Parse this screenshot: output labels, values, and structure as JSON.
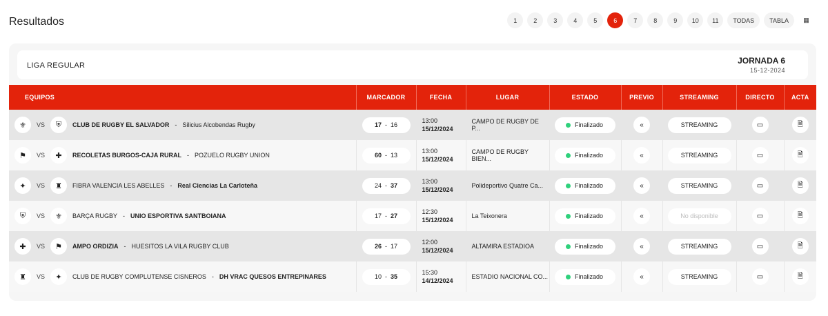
{
  "title": "Resultados",
  "pager": {
    "items": [
      "1",
      "2",
      "3",
      "4",
      "5",
      "6",
      "7",
      "8",
      "9",
      "10",
      "11",
      "TODAS",
      "TABLA"
    ],
    "active": "6",
    "grid_icon": "grid-icon"
  },
  "section": {
    "label": "LIGA REGULAR",
    "jornada": "JORNADA 6",
    "date": "15-12-2024"
  },
  "columns": [
    "EQUIPOS",
    "MARCADOR",
    "FECHA",
    "LUGAR",
    "ESTADO",
    "PREVIO",
    "STREAMING",
    "DIRECTO",
    "ACTA"
  ],
  "accent": "#e3230b",
  "status_color": "#2fd17c",
  "matches": [
    {
      "home": "CLUB DE RUGBY EL SALVADOR",
      "away": "Silicius Alcobendas Rugby",
      "hs": "17",
      "as": "16",
      "winner": "home",
      "time": "13:00",
      "date": "15/12/2024",
      "place": "CAMPO DE RUGBY DE P...",
      "status": "Finalizado",
      "streaming": "STREAMING",
      "vs": "VS"
    },
    {
      "home": "RECOLETAS BURGOS-CAJA RURAL",
      "away": "POZUELO RUGBY UNION",
      "hs": "60",
      "as": "13",
      "winner": "home",
      "time": "13:00",
      "date": "15/12/2024",
      "place": "CAMPO DE RUGBY BIEN...",
      "status": "Finalizado",
      "streaming": "STREAMING",
      "vs": "VS"
    },
    {
      "home": "FIBRA VALENCIA LES ABELLES",
      "away": "Real Ciencias La Carloteña",
      "hs": "24",
      "as": "37",
      "winner": "away",
      "time": "13:00",
      "date": "15/12/2024",
      "place": "Polideportivo Quatre Ca...",
      "status": "Finalizado",
      "streaming": "STREAMING",
      "vs": "VS"
    },
    {
      "home": "BARÇA RUGBY",
      "away": "UNIO ESPORTIVA SANTBOIANA",
      "hs": "17",
      "as": "27",
      "winner": "away",
      "time": "12:30",
      "date": "15/12/2024",
      "place": "La Teixonera",
      "status": "Finalizado",
      "streaming": "No disponible",
      "vs": "VS"
    },
    {
      "home": "AMPO ORDIZIA",
      "away": "HUESITOS LA VILA RUGBY CLUB",
      "hs": "26",
      "as": "17",
      "winner": "home",
      "time": "12:00",
      "date": "15/12/2024",
      "place": "ALTAMIRA ESTADIOA",
      "status": "Finalizado",
      "streaming": "STREAMING",
      "vs": "VS"
    },
    {
      "home": "CLUB DE RUGBY COMPLUTENSE CISNEROS",
      "away": "DH VRAC QUESOS ENTREPINARES",
      "hs": "10",
      "as": "35",
      "winner": "away",
      "time": "15:30",
      "date": "14/12/2024",
      "place": "ESTADIO NACIONAL CO...",
      "status": "Finalizado",
      "streaming": "STREAMING",
      "vs": "VS"
    }
  ]
}
